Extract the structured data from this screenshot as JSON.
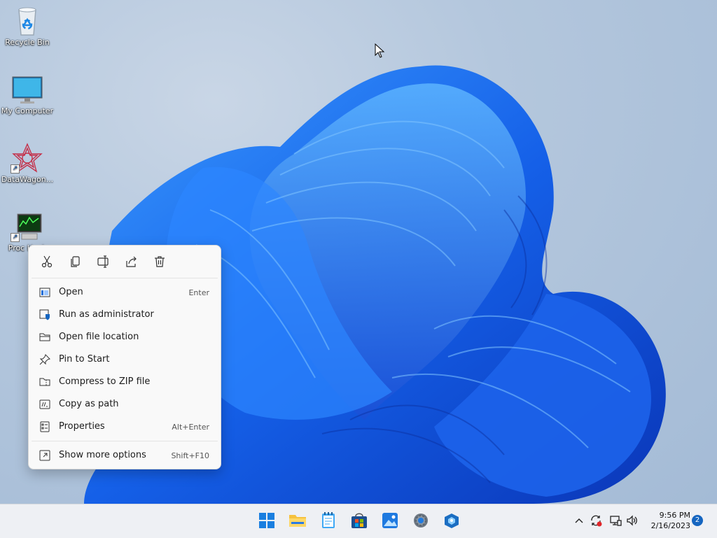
{
  "desktop": {
    "icons": [
      {
        "label": "Recycle Bin",
        "icon": "recycle-bin-icon"
      },
      {
        "label": "My Computer",
        "icon": "monitor-icon"
      },
      {
        "label": "DataWagon...",
        "icon": "datawagon-icon"
      },
      {
        "label": "Proc Hack",
        "icon": "process-hacker-icon"
      }
    ]
  },
  "context_menu": {
    "toolbar": [
      "cut-icon",
      "copy-icon",
      "rename-icon",
      "share-icon",
      "delete-icon"
    ],
    "items": [
      {
        "label": "Open",
        "shortcut": "Enter",
        "icon": "open-icon"
      },
      {
        "label": "Run as administrator",
        "shortcut": "",
        "icon": "shield-icon"
      },
      {
        "label": "Open file location",
        "shortcut": "",
        "icon": "folder-icon"
      },
      {
        "label": "Pin to Start",
        "shortcut": "",
        "icon": "pin-icon"
      },
      {
        "label": "Compress to ZIP file",
        "shortcut": "",
        "icon": "zip-icon"
      },
      {
        "label": "Copy as path",
        "shortcut": "",
        "icon": "path-icon"
      },
      {
        "label": "Properties",
        "shortcut": "Alt+Enter",
        "icon": "properties-icon"
      },
      {
        "label": "Show more options",
        "shortcut": "Shift+F10",
        "icon": "more-options-icon"
      }
    ]
  },
  "taskbar": {
    "apps": [
      "start-icon",
      "file-explorer-icon",
      "notepad-icon",
      "store-icon",
      "photos-icon",
      "settings-icon",
      "app-icon"
    ],
    "tray": [
      "chevron-up-icon",
      "sync-icon",
      "network-icon",
      "volume-icon"
    ],
    "time": "9:56 PM",
    "date": "2/16/2023",
    "notification_count": "2"
  },
  "colors": {
    "accent": "#0067c0",
    "bloom": "#1a6cf0"
  }
}
